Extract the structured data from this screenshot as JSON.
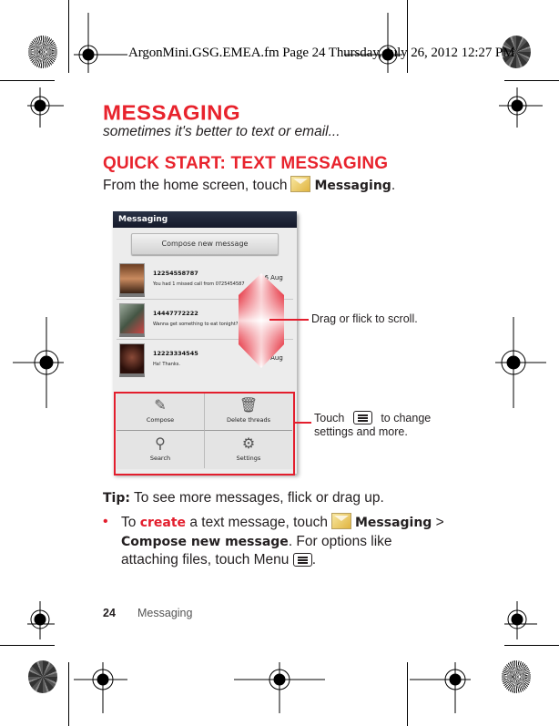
{
  "print_slug": "ArgonMini.GSG.EMEA.fm  Page 24  Thursday, July 26, 2012  12:27 PM",
  "heading": "MESSAGING",
  "subtitle": "sometimes it's better to text or email...",
  "section_heading": "QUICK START: TEXT MESSAGING",
  "intro": {
    "prefix": "From the home screen, touch",
    "app_name": "Messaging",
    "suffix": ".",
    "icon": "messaging-envelope-icon"
  },
  "phone": {
    "title": "Messaging",
    "compose_button": "Compose new message",
    "threads": [
      {
        "number": "12254558787",
        "snippet": "You had 1 missed call from 0725454587",
        "date": "16 Aug"
      },
      {
        "number": "14447772222",
        "snippet": "Wanna get something to eat tonight?",
        "date": ""
      },
      {
        "number": "12223334545",
        "snippet": "Ha! Thanks.",
        "date": "16 Aug"
      }
    ],
    "menu": [
      {
        "label": "Compose",
        "icon": "compose-icon"
      },
      {
        "label": "Delete threads",
        "icon": "trash-icon"
      },
      {
        "label": "Search",
        "icon": "search-icon"
      },
      {
        "label": "Settings",
        "icon": "settings-icon"
      }
    ]
  },
  "callouts": {
    "scroll": "Drag or flick to scroll.",
    "menu_prefix": "Touch",
    "menu_suffix_line1": "to change",
    "menu_line2": "settings and more."
  },
  "tip": {
    "label": "Tip:",
    "text": "To see more messages, flick or drag up."
  },
  "bullet": {
    "to": "To",
    "action": "create",
    "text1": "a text message, touch",
    "app_name": "Messaging",
    "sep": ">",
    "compose": "Compose new message",
    "text2": ". For options like attaching files, touch Menu",
    "end": "."
  },
  "footer": {
    "page_number": "24",
    "section": "Messaging"
  },
  "colors": {
    "accent_red": "#e8232d",
    "text": "#231f20",
    "titlebar": "#1c2233"
  }
}
